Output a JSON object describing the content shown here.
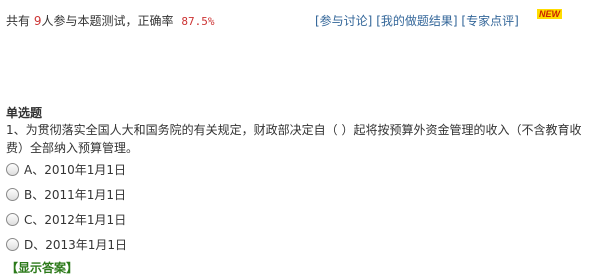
{
  "stats": {
    "prefix": "共有",
    "count": "9",
    "middle": "人参与本题测试，正确率",
    "rate": "87.5%"
  },
  "links": [
    "[参与讨论]",
    "[我的做题结果]",
    "[专家点评]"
  ],
  "new_badge": "NEW",
  "section_title": "单选题",
  "question": "1、为贯彻落实全国人大和国务院的有关规定，财政部决定自（ ）起将按预算外资金管理的收入（不含教育收费）全部纳入预算管理。",
  "options": [
    "A、2010年1月1日",
    "B、2011年1月1日",
    "C、2012年1月1日",
    "D、2013年1月1日"
  ],
  "show_answer": "【显示答案】"
}
